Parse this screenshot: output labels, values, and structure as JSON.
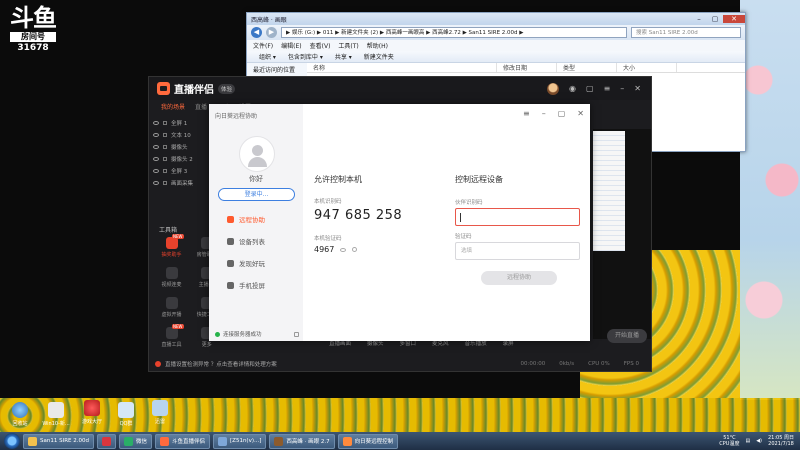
{
  "douyu": {
    "logo": "斗鱼",
    "room_label": "房间号",
    "room_number": "31678"
  },
  "explorer": {
    "title": "西高峰 · 画眼",
    "path": "▶ 娱乐 (G:) ▶ 011 ▶ 新建文件夹 (2) ▶ 西高峰一画眼高 ▶ 西高峰2.72 ▶ San11 SIRE 2.00d ▶",
    "search_placeholder": "搜索 San11 SIRE 2.00d",
    "menu": [
      "文件(F)",
      "编辑(E)",
      "查看(V)",
      "工具(T)",
      "帮助(H)"
    ],
    "toolbar": [
      "组织 ▾",
      "包含到库中 ▾",
      "共享 ▾",
      "新建文件夹"
    ],
    "sidebar_item": "最近访问的位置",
    "columns": [
      "名称",
      "修改日期",
      "类型",
      "大小"
    ]
  },
  "app": {
    "name": "直播伴侣",
    "badge": "体验",
    "tabs": [
      "我的场景",
      "直播",
      "互动",
      "设置"
    ],
    "scenes": [
      "全屏 1",
      "文本 10",
      "摄像头",
      "摄像头 2",
      "全屏 3",
      "画面采集"
    ],
    "tools_title": "工具箱",
    "tools": [
      {
        "label": "抽奖助手",
        "hot": "NEW",
        "red": true
      },
      {
        "label": "房管助手",
        "hot": "",
        "red": false
      },
      {
        "label": "视频连麦",
        "hot": "",
        "red": false
      },
      {
        "label": "主播PK",
        "hot": "",
        "red": false
      },
      {
        "label": "虚拟开播",
        "hot": "",
        "red": false
      },
      {
        "label": "快捷工具",
        "hot": "",
        "red": false
      },
      {
        "label": "直播工具",
        "hot": "NEW",
        "red": false
      },
      {
        "label": "更多",
        "hot": "",
        "red": false
      }
    ],
    "bottom_items": [
      "直播画面",
      "摄像头",
      "多窗口",
      "麦克风",
      "音乐播放",
      "录屏"
    ],
    "status": "直播设置检测异常 ？点击查看详情和处理方案",
    "status_right": [
      "00:00:00",
      "0kb/s",
      "CPU 0%",
      "FPS 0"
    ],
    "start_button": "开始直播",
    "header_icons": [
      "◉",
      "▢",
      "≡",
      "–",
      "✕"
    ]
  },
  "dialog": {
    "title": "向日葵远程协助",
    "hello": "你好",
    "login": "登录中...",
    "nav": [
      "远程协助",
      "设备列表",
      "发现好玩",
      "手机投屏"
    ],
    "server_status": "连接服务器成功",
    "allow_title": "允许控制本机",
    "device_id_label": "本机识别码",
    "device_id": "947 685 258",
    "pwd_label": "本机验证码",
    "pwd": "4967",
    "control_title": "控制远程设备",
    "partner_label": "伙伴识别码",
    "verify_label": "验证码",
    "verify_placeholder": "选填",
    "remote_button": "远程协助",
    "ctrl": [
      "≡",
      "–",
      "▢",
      "✕"
    ]
  },
  "desktop_icons": [
    "回收站",
    "Win10-新...",
    "游戏大厅",
    "QQ群",
    "迅雷"
  ],
  "taskbar": {
    "tasks": [
      {
        "label": "San11 SIRE 2.00d",
        "color": "#f2c14e"
      },
      {
        "label": "",
        "color": "#d9363e"
      },
      {
        "label": "微信",
        "color": "#2aae67"
      },
      {
        "label": "斗鱼直播伴侣",
        "color": "#ff6a3d"
      },
      {
        "label": "[Z51n(v)...]",
        "color": "#7ea7d8"
      },
      {
        "label": "西高峰 · 画眼 2.7",
        "color": "#8c5b2d"
      },
      {
        "label": "向日葵远程控制",
        "color": "#ff8a3d"
      }
    ],
    "temp": "51°C",
    "temp_label": "CPU温度",
    "time": "21:05 周日",
    "date": "2021/7/18"
  },
  "colors": {
    "accent": "#ff5a2e",
    "link": "#3d7fe0",
    "error": "#e8574a",
    "online": "#27b34a"
  }
}
